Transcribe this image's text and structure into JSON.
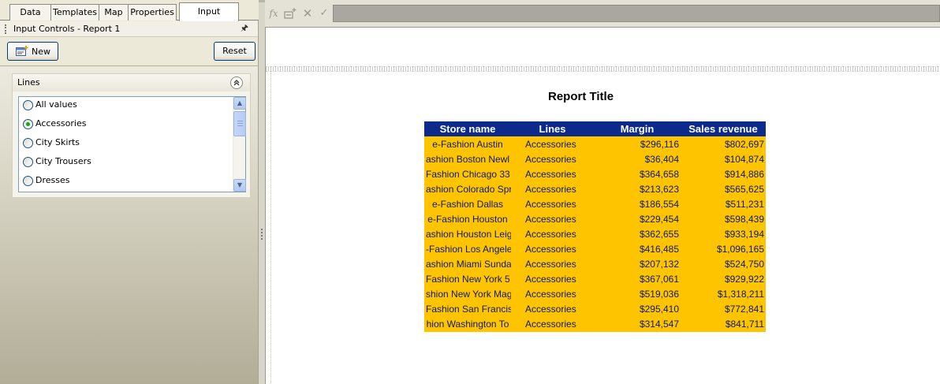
{
  "tabs": [
    {
      "label": "Data"
    },
    {
      "label": "Templates"
    },
    {
      "label": "Map"
    },
    {
      "label": "Properties"
    },
    {
      "label": "Input Controls",
      "active": true
    }
  ],
  "panel": {
    "title": "Input Controls - Report 1",
    "new_label": "New",
    "reset_label": "Reset",
    "group": {
      "title": "Lines",
      "items": [
        {
          "label": "All values",
          "checked": false
        },
        {
          "label": "Accessories",
          "checked": true
        },
        {
          "label": "City Skirts",
          "checked": false
        },
        {
          "label": "City Trousers",
          "checked": false
        },
        {
          "label": "Dresses",
          "checked": false
        }
      ]
    }
  },
  "formula_bar": {
    "icons": [
      "fx-icon",
      "insert-variable-icon",
      "cancel-icon",
      "validate-icon"
    ],
    "value": ""
  },
  "report": {
    "title": "Report Title",
    "columns": [
      "Store name",
      "Lines",
      "Margin",
      "Sales revenue"
    ],
    "rows": [
      [
        "e-Fashion Austin",
        "Accessories",
        "$296,116",
        "$802,697"
      ],
      [
        "ashion Boston Newl",
        "Accessories",
        "$36,404",
        "$104,874"
      ],
      [
        "Fashion Chicago 33",
        "Accessories",
        "$364,658",
        "$914,886"
      ],
      [
        "ashion Colorado Spr",
        "Accessories",
        "$213,623",
        "$565,625"
      ],
      [
        "e-Fashion Dallas",
        "Accessories",
        "$186,554",
        "$511,231"
      ],
      [
        "e-Fashion Houston",
        "Accessories",
        "$229,454",
        "$598,439"
      ],
      [
        "ashion Houston Leig",
        "Accessories",
        "$362,655",
        "$933,194"
      ],
      [
        "-Fashion Los Angele",
        "Accessories",
        "$416,485",
        "$1,096,165"
      ],
      [
        "ashion Miami Sunda",
        "Accessories",
        "$207,132",
        "$524,750"
      ],
      [
        "Fashion New York 5",
        "Accessories",
        "$367,061",
        "$929,922"
      ],
      [
        "shion New York Mag",
        "Accessories",
        "$519,036",
        "$1,318,211"
      ],
      [
        "Fashion San Francis",
        "Accessories",
        "$295,410",
        "$772,841"
      ],
      [
        "hion Washington To",
        "Accessories",
        "$314,547",
        "$841,711"
      ]
    ]
  },
  "colors": {
    "table_header_bg": "#0b2a8c",
    "table_body_bg": "#ffc400",
    "table_body_text": "#0b1a59"
  }
}
